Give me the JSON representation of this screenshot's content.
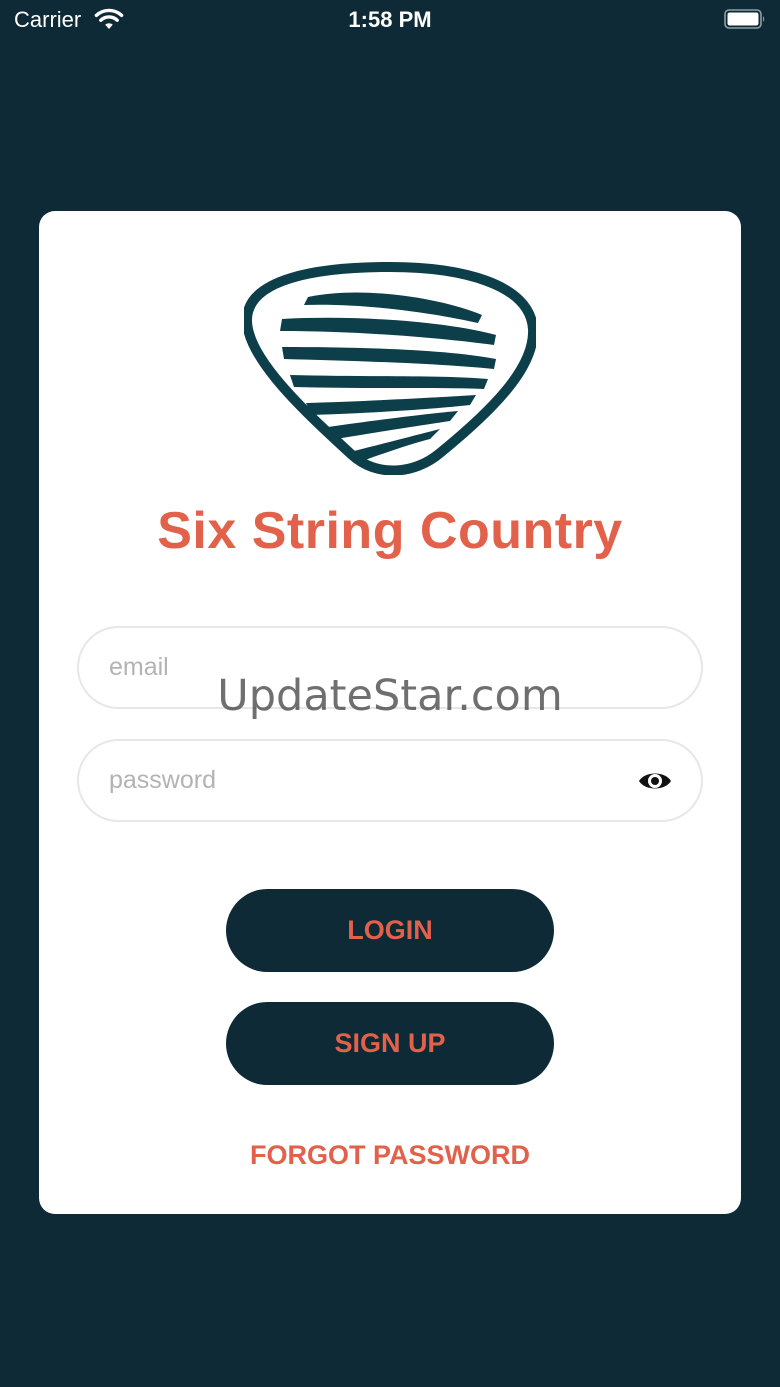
{
  "status_bar": {
    "carrier": "Carrier",
    "time": "1:58 PM",
    "wifi_icon": "wifi-icon",
    "battery_icon": "battery-icon"
  },
  "login_card": {
    "logo_icon": "guitar-pick-logo-icon",
    "title": "Six String Country",
    "email": {
      "placeholder": "email",
      "value": ""
    },
    "password": {
      "placeholder": "password",
      "value": "",
      "toggle_icon": "eye-icon"
    },
    "login_label": "LOGIN",
    "signup_label": "SIGN UP",
    "forgot_label": "FORGOT PASSWORD"
  },
  "watermark": "UpdateStar.com",
  "colors": {
    "background": "#0d2a36",
    "card": "#ffffff",
    "accent": "#e2614b",
    "field_border": "#e7e7e7",
    "placeholder": "#b3b3b3"
  }
}
